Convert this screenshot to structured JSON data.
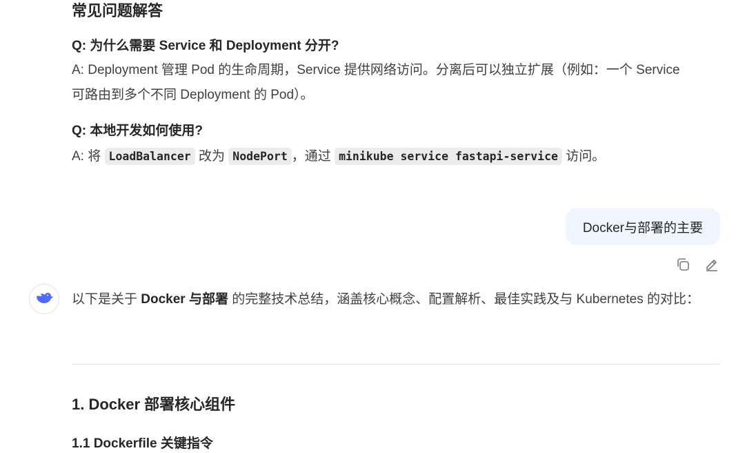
{
  "faq": {
    "heading": "常见问题解答",
    "q1": "Q: 为什么需要 Service 和 Deployment 分开?",
    "a1": "A: Deployment 管理 Pod 的生命周期，Service 提供网络访问。分离后可以独立扩展（例如：一个 Service 可路由到多个不同 Deployment 的 Pod）。",
    "q2": "Q: 本地开发如何使用?",
    "a2_prefix": "A: 将 ",
    "a2_code1": "LoadBalancer",
    "a2_mid1": " 改为 ",
    "a2_code2": "NodePort",
    "a2_mid2": "，通过 ",
    "a2_code3": "minikube service fastapi-service",
    "a2_suffix": " 访问。"
  },
  "user_message": {
    "text": "Docker与部署的主要",
    "actions": {
      "copy_icon": "copy-icon",
      "edit_icon": "edit-icon"
    }
  },
  "assistant": {
    "avatar_icon": "whale-logo-icon",
    "intro_prefix": "以下是关于 ",
    "intro_bold": "Docker 与部署",
    "intro_suffix": " 的完整技术总结，涵盖核心概念、配置解析、最佳实践及与 Kubernetes 的对比："
  },
  "section": {
    "h2": "1. Docker 部署核心组件",
    "h3": "1.1 Dockerfile 关键指令"
  },
  "colors": {
    "bubble_bg": "#eff6ff",
    "accent": "#4d6bfe",
    "text": "#404040"
  }
}
